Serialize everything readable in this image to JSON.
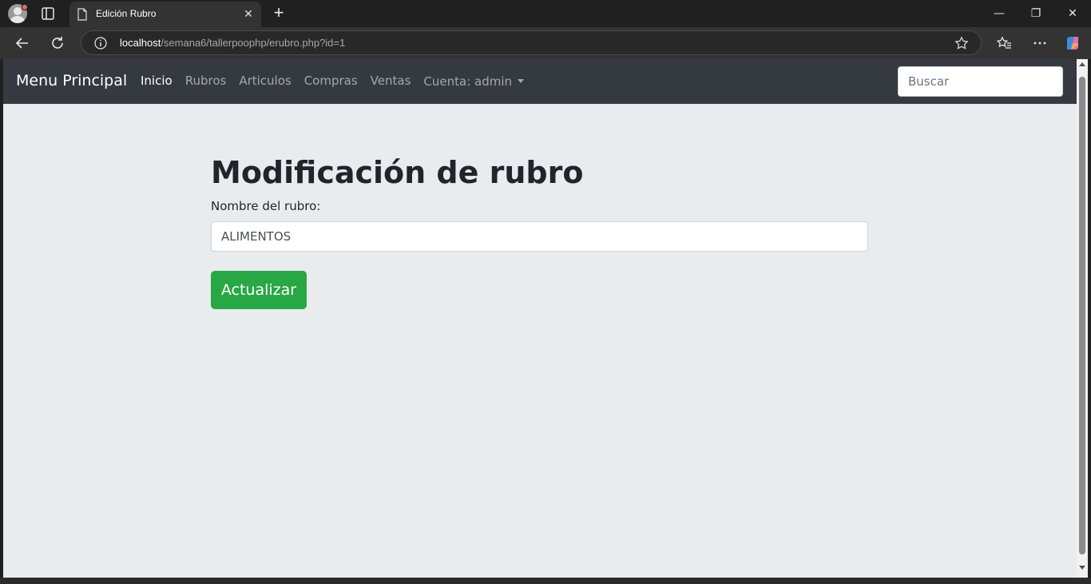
{
  "browser": {
    "tab_title": "Edición Rubro",
    "url_host": "localhost",
    "url_path": "/semana6/tallerpoophp/erubro.php?id=1"
  },
  "navbar": {
    "brand": "Menu Principal",
    "links": [
      {
        "label": "Inicio",
        "active": true
      },
      {
        "label": "Rubros"
      },
      {
        "label": "Articulos"
      },
      {
        "label": "Compras"
      },
      {
        "label": "Ventas"
      },
      {
        "label": "Cuenta: admin"
      }
    ],
    "search_placeholder": "Buscar"
  },
  "form": {
    "heading": "Modificación de rubro",
    "label": "Nombre del rubro:",
    "value": "ALIMENTOS",
    "submit_label": "Actualizar"
  },
  "colors": {
    "navbar_bg": "#343a40",
    "page_bg": "#e9ecef",
    "success": "#28a745"
  }
}
